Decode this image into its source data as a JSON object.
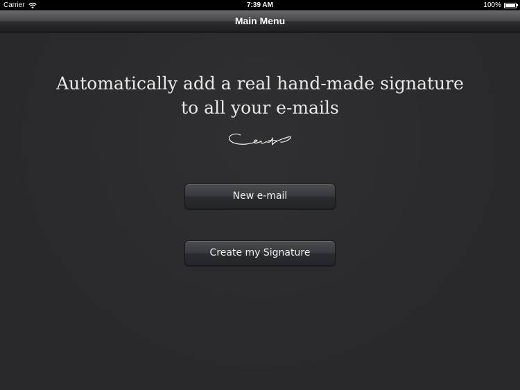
{
  "status_bar": {
    "carrier": "Carrier",
    "time": "7:39 AM",
    "battery": "100%",
    "battery_level": 1.0
  },
  "nav_bar": {
    "title": "Main Menu"
  },
  "main": {
    "headline_line1": "Automatically add a real hand-made signature",
    "headline_line2": "to all your e-mails",
    "signature_icon": "signature-sample",
    "buttons": {
      "new_email": "New e-mail",
      "create_signature": "Create my Signature"
    }
  },
  "colors": {
    "background": "#29292b",
    "text": "#e8e8e8",
    "button_text": "#f0f0f0"
  }
}
